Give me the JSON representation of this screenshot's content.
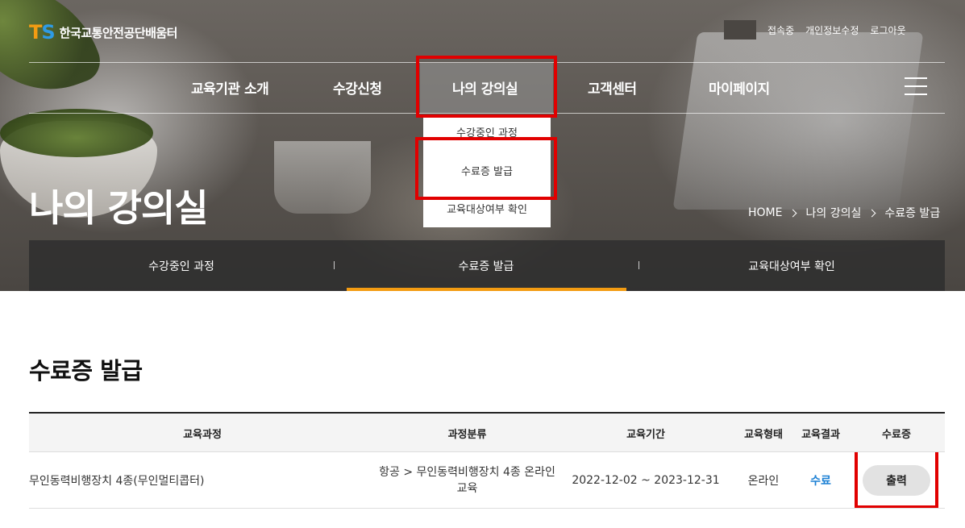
{
  "brand": {
    "logo_mark_t": "T",
    "logo_mark_s": "S",
    "name": "한국교통안전공단배움터"
  },
  "util_links": [
    "접속중",
    "개인정보수정",
    "로그아웃"
  ],
  "nav": {
    "items": [
      "교육기관 소개",
      "수강신청",
      "나의 강의실",
      "고객센터",
      "마이페이지"
    ],
    "active_index": 2,
    "dropdown": [
      "수강중인 과정",
      "수료증 발급",
      "교육대상여부 확인"
    ]
  },
  "hero": {
    "title": "나의 강의실",
    "breadcrumb": [
      "HOME",
      "나의 강의실",
      "수료증 발급"
    ]
  },
  "subtabs": {
    "items": [
      "수강중인 과정",
      "수료증 발급",
      "교육대상여부 확인"
    ],
    "active_index": 1
  },
  "section": {
    "title": "수료증 발급"
  },
  "table": {
    "headers": [
      "교육과정",
      "과정분류",
      "교육기간",
      "교육형태",
      "교육결과",
      "수료증"
    ],
    "rows": [
      {
        "course": "무인동력비행장치 4종(무인멀티콥터)",
        "category_line1": "항공 > 무인동력비행장치 4종 온라인",
        "category_line2": "교육",
        "period": "2022-12-02 ~ 2023-12-31",
        "type": "온라인",
        "result": "수료",
        "certificate_button": "출력"
      }
    ]
  },
  "colors": {
    "accent_orange": "#f39c12",
    "logo_blue": "#2e9be6",
    "highlight_red": "#e10000",
    "result_blue": "#1a7fd4"
  }
}
